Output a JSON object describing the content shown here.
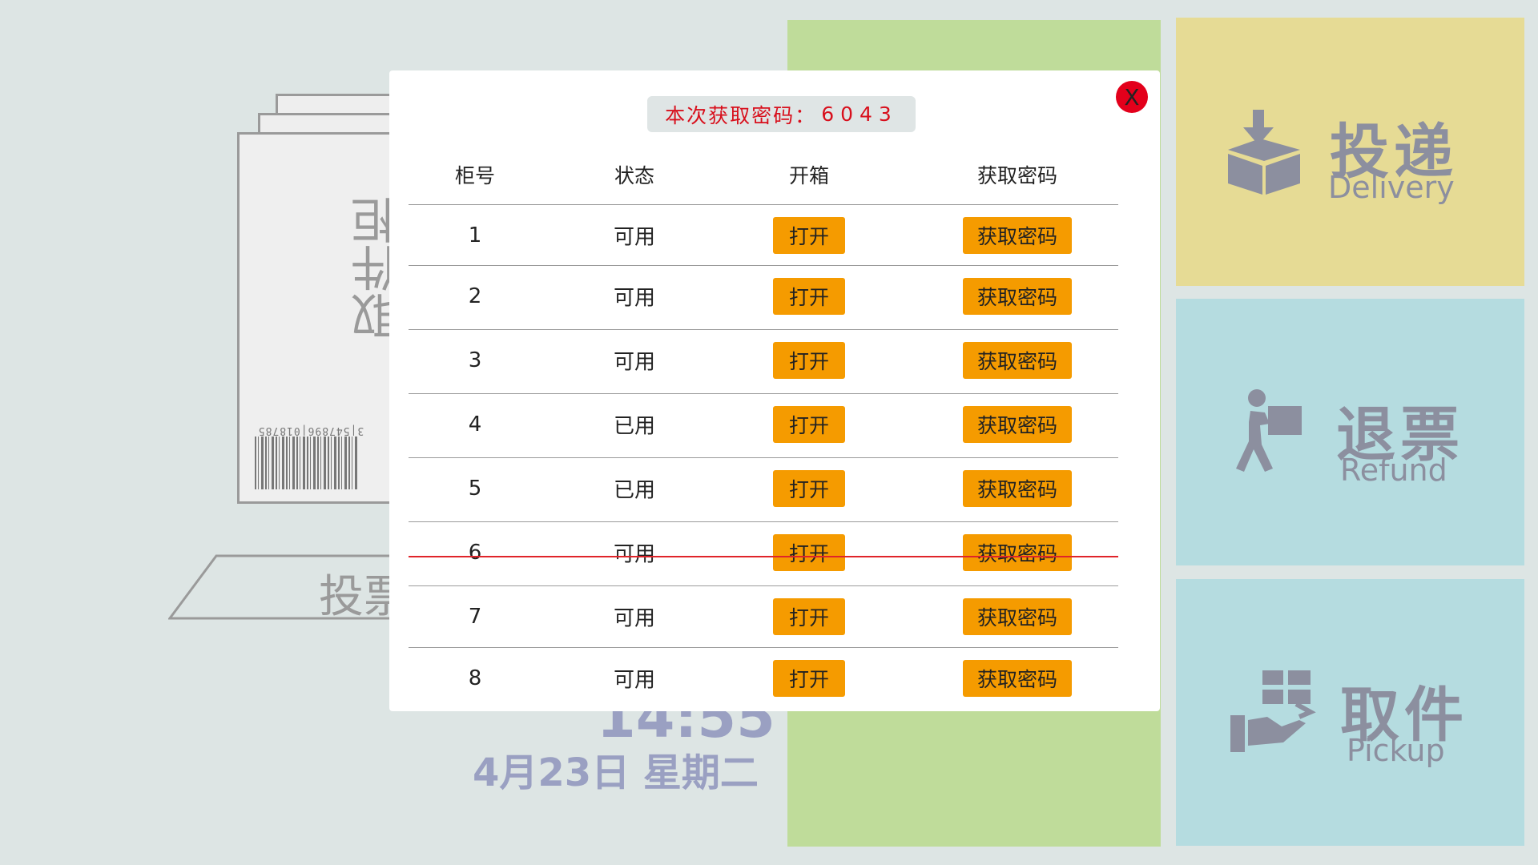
{
  "background": {
    "vertical_text": "取件柜",
    "barcode_number": "3|547896|018785",
    "tray_label": "投票",
    "clock": "14:55",
    "date": "4月23日 星期二"
  },
  "tiles": [
    {
      "cn": "投递",
      "en": "Delivery",
      "icon": "box-delivery-icon",
      "color": "#e6db95"
    },
    {
      "cn": "退票",
      "en": "Refund",
      "icon": "person-carry-icon",
      "color": "#b5dce0"
    },
    {
      "cn": "取件",
      "en": "Pickup",
      "icon": "hand-pickup-icon",
      "color": "#b5dce0"
    }
  ],
  "modal": {
    "close_label": "X",
    "password_label": "本次获取密码：",
    "password_code": "6043",
    "headers": [
      "柜号",
      "状态",
      "开箱",
      "获取密码"
    ],
    "rows": [
      {
        "no": "1",
        "status": "可用",
        "open": "打开",
        "pwd": "获取密码"
      },
      {
        "no": "2",
        "status": "可用",
        "open": "打开",
        "pwd": "获取密码"
      },
      {
        "no": "3",
        "status": "可用",
        "open": "打开",
        "pwd": "获取密码"
      },
      {
        "no": "4",
        "status": "已用",
        "open": "打开",
        "pwd": "获取密码"
      },
      {
        "no": "5",
        "status": "已用",
        "open": "打开",
        "pwd": "获取密码"
      },
      {
        "no": "6",
        "status": "可用",
        "open": "打开",
        "pwd": "获取密码"
      },
      {
        "no": "7",
        "status": "可用",
        "open": "打开",
        "pwd": "获取密码"
      },
      {
        "no": "8",
        "status": "可用",
        "open": "打开",
        "pwd": "获取密码"
      }
    ],
    "button_color": "#f59b00",
    "strike_color": "#e0242a"
  }
}
